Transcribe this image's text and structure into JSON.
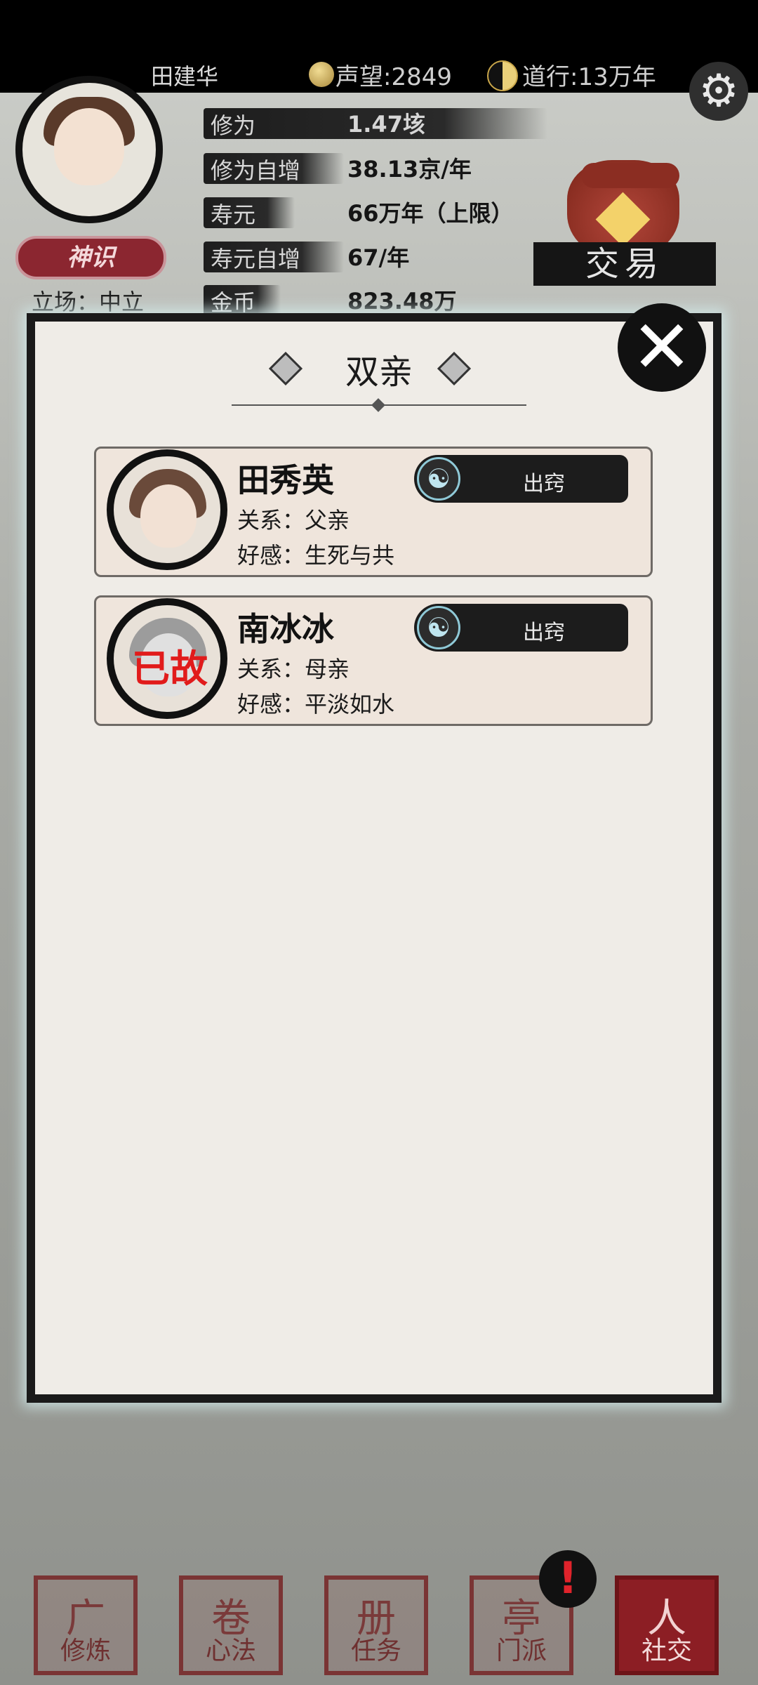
{
  "header": {
    "username": "田建华",
    "reputation": "声望:2849",
    "dao": "道行:13万年",
    "shenshi_label": "神识",
    "stance": "立场：中立",
    "trade_label": "交易",
    "stats": [
      {
        "label": "修为",
        "value": "1.47垓"
      },
      {
        "label": "修为自增",
        "value": "38.13京/年"
      },
      {
        "label": "寿元",
        "value": "66万年（上限）"
      },
      {
        "label": "寿元自增",
        "value": "67/年"
      },
      {
        "label": "金币",
        "value": "823.48万"
      }
    ]
  },
  "dialog": {
    "title": "双亲",
    "members": [
      {
        "name": "田秀英",
        "relation": "关系：父亲",
        "favor": "好感：生死与共",
        "action": "出窍",
        "dead_label": ""
      },
      {
        "name": "南冰冰",
        "relation": "关系：母亲",
        "favor": "好感：平淡如水",
        "action": "出窍",
        "dead_label": "已故"
      }
    ]
  },
  "bottom_nav": {
    "items": [
      {
        "label": "修炼",
        "glyph": "广"
      },
      {
        "label": "心法",
        "glyph": "卷"
      },
      {
        "label": "任务",
        "glyph": "册"
      },
      {
        "label": "门派",
        "glyph": "亭"
      },
      {
        "label": "社交",
        "glyph": "人"
      }
    ],
    "alert": "!"
  },
  "icons": {
    "settings": "gear-icon",
    "close": "close-icon",
    "meditate": "meditation-icon"
  }
}
